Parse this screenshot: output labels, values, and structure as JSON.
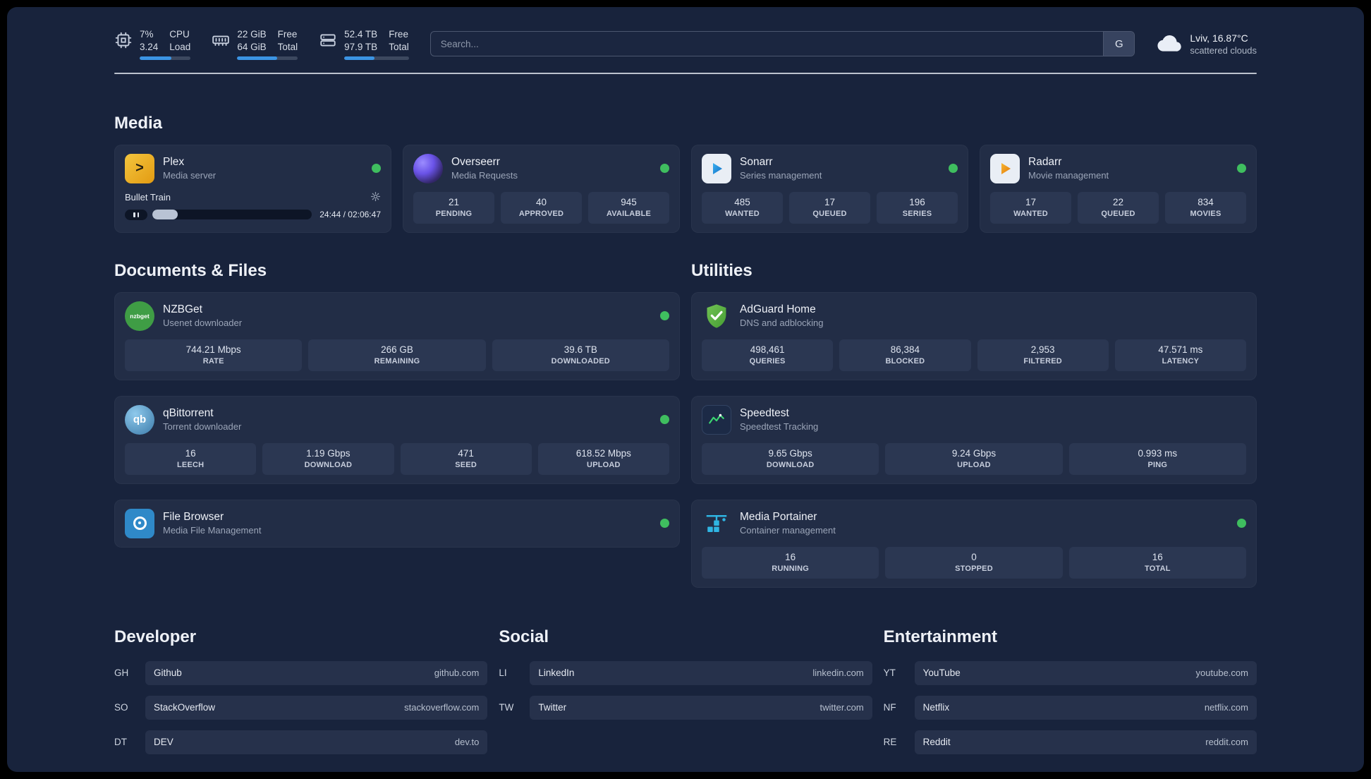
{
  "topbar": {
    "cpu": {
      "line1": "7%",
      "line2": "3.24",
      "label1": "CPU",
      "label2": "Load",
      "progress": 62
    },
    "memory": {
      "line1": "22 GiB",
      "line2": "64 GiB",
      "label1": "Free",
      "label2": "Total",
      "progress": 66
    },
    "disk": {
      "line1": "52.4 TB",
      "line2": "97.9 TB",
      "label1": "Free",
      "label2": "Total",
      "progress": 47
    },
    "search": {
      "placeholder": "Search...",
      "engine": "G"
    },
    "weather": {
      "location": "Lviv, 16.87°C",
      "condition": "scattered clouds"
    }
  },
  "icons": {
    "plex_glyph": ">",
    "qb_glyph": "qb",
    "nzbget_glyph": "nzbget"
  },
  "sections": {
    "media": "Media",
    "documents": "Documents & Files",
    "utilities": "Utilities"
  },
  "apps": {
    "plex": {
      "name": "Plex",
      "subtitle": "Media server",
      "now_playing": {
        "title": "Bullet Train",
        "time": "24:44 / 02:06:47",
        "progress": 16
      }
    },
    "overseerr": {
      "name": "Overseerr",
      "subtitle": "Media Requests",
      "stats": [
        {
          "value": "21",
          "label": "PENDING"
        },
        {
          "value": "40",
          "label": "APPROVED"
        },
        {
          "value": "945",
          "label": "AVAILABLE"
        }
      ]
    },
    "sonarr": {
      "name": "Sonarr",
      "subtitle": "Series management",
      "stats": [
        {
          "value": "485",
          "label": "WANTED"
        },
        {
          "value": "17",
          "label": "QUEUED"
        },
        {
          "value": "196",
          "label": "SERIES"
        }
      ]
    },
    "radarr": {
      "name": "Radarr",
      "subtitle": "Movie management",
      "stats": [
        {
          "value": "17",
          "label": "WANTED"
        },
        {
          "value": "22",
          "label": "QUEUED"
        },
        {
          "value": "834",
          "label": "MOVIES"
        }
      ]
    },
    "nzbget": {
      "name": "NZBGet",
      "subtitle": "Usenet downloader",
      "stats": [
        {
          "value": "744.21 Mbps",
          "label": "RATE"
        },
        {
          "value": "266 GB",
          "label": "REMAINING"
        },
        {
          "value": "39.6 TB",
          "label": "DOWNLOADED"
        }
      ]
    },
    "qbittorrent": {
      "name": "qBittorrent",
      "subtitle": "Torrent downloader",
      "stats": [
        {
          "value": "16",
          "label": "LEECH"
        },
        {
          "value": "1.19 Gbps",
          "label": "DOWNLOAD"
        },
        {
          "value": "471",
          "label": "SEED"
        },
        {
          "value": "618.52 Mbps",
          "label": "UPLOAD"
        }
      ]
    },
    "filebrowser": {
      "name": "File Browser",
      "subtitle": "Media File Management"
    },
    "adguard": {
      "name": "AdGuard Home",
      "subtitle": "DNS and adblocking",
      "stats": [
        {
          "value": "498,461",
          "label": "QUERIES"
        },
        {
          "value": "86,384",
          "label": "BLOCKED"
        },
        {
          "value": "2,953",
          "label": "FILTERED"
        },
        {
          "value": "47.571 ms",
          "label": "LATENCY"
        }
      ]
    },
    "speedtest": {
      "name": "Speedtest",
      "subtitle": "Speedtest Tracking",
      "stats": [
        {
          "value": "9.65 Gbps",
          "label": "DOWNLOAD"
        },
        {
          "value": "9.24 Gbps",
          "label": "UPLOAD"
        },
        {
          "value": "0.993 ms",
          "label": "PING"
        }
      ]
    },
    "portainer": {
      "name": "Media Portainer",
      "subtitle": "Container management",
      "stats": [
        {
          "value": "16",
          "label": "RUNNING"
        },
        {
          "value": "0",
          "label": "STOPPED"
        },
        {
          "value": "16",
          "label": "TOTAL"
        }
      ]
    }
  },
  "bookmarks": {
    "developer": {
      "title": "Developer",
      "items": [
        {
          "abbr": "GH",
          "name": "Github",
          "url": "github.com"
        },
        {
          "abbr": "SO",
          "name": "StackOverflow",
          "url": "stackoverflow.com"
        },
        {
          "abbr": "DT",
          "name": "DEV",
          "url": "dev.to"
        }
      ]
    },
    "social": {
      "title": "Social",
      "items": [
        {
          "abbr": "LI",
          "name": "LinkedIn",
          "url": "linkedin.com"
        },
        {
          "abbr": "TW",
          "name": "Twitter",
          "url": "twitter.com"
        }
      ]
    },
    "entertainment": {
      "title": "Entertainment",
      "items": [
        {
          "abbr": "YT",
          "name": "YouTube",
          "url": "youtube.com"
        },
        {
          "abbr": "NF",
          "name": "Netflix",
          "url": "netflix.com"
        },
        {
          "abbr": "RE",
          "name": "Reddit",
          "url": "reddit.com"
        }
      ]
    }
  }
}
